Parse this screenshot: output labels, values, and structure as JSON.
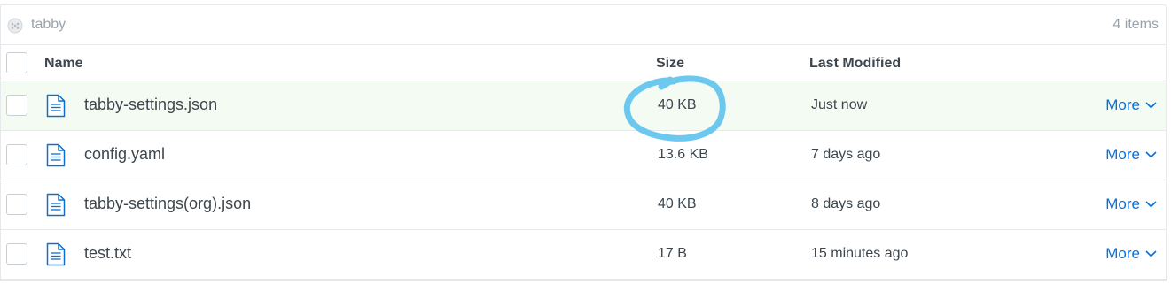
{
  "folder": {
    "name": "tabby",
    "count_label": "4 items",
    "icon": "folder-shared-icon"
  },
  "columns": {
    "name": "Name",
    "size": "Size",
    "modified": "Last Modified"
  },
  "rows": [
    {
      "name": "tabby-settings.json",
      "size": "40 KB",
      "modified": "Just now",
      "action": "More",
      "icon": "file-text-icon",
      "selected": true
    },
    {
      "name": "config.yaml",
      "size": "13.6 KB",
      "modified": "7 days ago",
      "action": "More",
      "icon": "file-text-icon",
      "selected": false
    },
    {
      "name": "tabby-settings(org).json",
      "size": "40 KB",
      "modified": "8 days ago",
      "action": "More",
      "icon": "file-text-icon",
      "selected": false
    },
    {
      "name": "test.txt",
      "size": "17 B",
      "modified": "15 minutes ago",
      "action": "More",
      "icon": "file-text-icon",
      "selected": false
    }
  ],
  "colors": {
    "accent": "#0a70d6",
    "selected_row": "#f3fbf3",
    "annotation": "#5bc8f0",
    "muted_text": "#9aa3ab"
  }
}
